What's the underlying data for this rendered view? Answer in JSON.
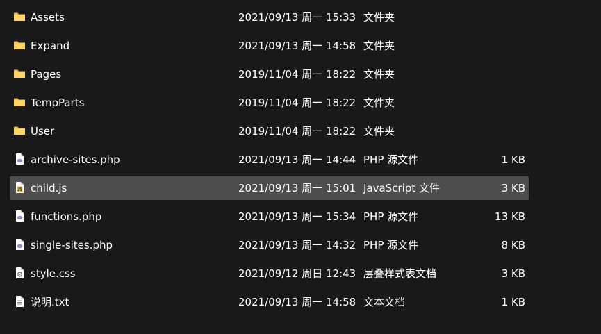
{
  "files": [
    {
      "name": "Assets",
      "date": "2021/09/13 周一 15:33",
      "type": "文件夹",
      "size": "",
      "icon": "folder-icon"
    },
    {
      "name": "Expand",
      "date": "2021/09/13 周一 14:58",
      "type": "文件夹",
      "size": "",
      "icon": "folder-icon"
    },
    {
      "name": "Pages",
      "date": "2019/11/04 周一 18:22",
      "type": "文件夹",
      "size": "",
      "icon": "folder-icon"
    },
    {
      "name": "TempParts",
      "date": "2019/11/04 周一 18:22",
      "type": "文件夹",
      "size": "",
      "icon": "folder-icon"
    },
    {
      "name": "User",
      "date": "2019/11/04 周一 18:22",
      "type": "文件夹",
      "size": "",
      "icon": "folder-icon"
    },
    {
      "name": "archive-sites.php",
      "date": "2021/09/13 周一 14:44",
      "type": "PHP 源文件",
      "size": "1 KB",
      "icon": "php-file-icon"
    },
    {
      "name": "child.js",
      "date": "2021/09/13 周一 15:01",
      "type": "JavaScript 文件",
      "size": "3 KB",
      "icon": "javascript-file-icon",
      "selected": true
    },
    {
      "name": "functions.php",
      "date": "2021/09/13 周一 15:34",
      "type": "PHP 源文件",
      "size": "13 KB",
      "icon": "php-file-icon"
    },
    {
      "name": "single-sites.php",
      "date": "2021/09/13 周一 14:32",
      "type": "PHP 源文件",
      "size": "8 KB",
      "icon": "php-file-icon"
    },
    {
      "name": "style.css",
      "date": "2021/09/12 周日 12:43",
      "type": "层叠样式表文档",
      "size": "3 KB",
      "icon": "css-file-icon"
    },
    {
      "name": "说明.txt",
      "date": "2021/09/13 周一 14:58",
      "type": "文本文档",
      "size": "1 KB",
      "icon": "text-file-icon"
    }
  ],
  "colors": {
    "background": "#191919",
    "selected_row": "#4d4d4d",
    "text": "#ffffff",
    "folder": "#f5c14b"
  }
}
